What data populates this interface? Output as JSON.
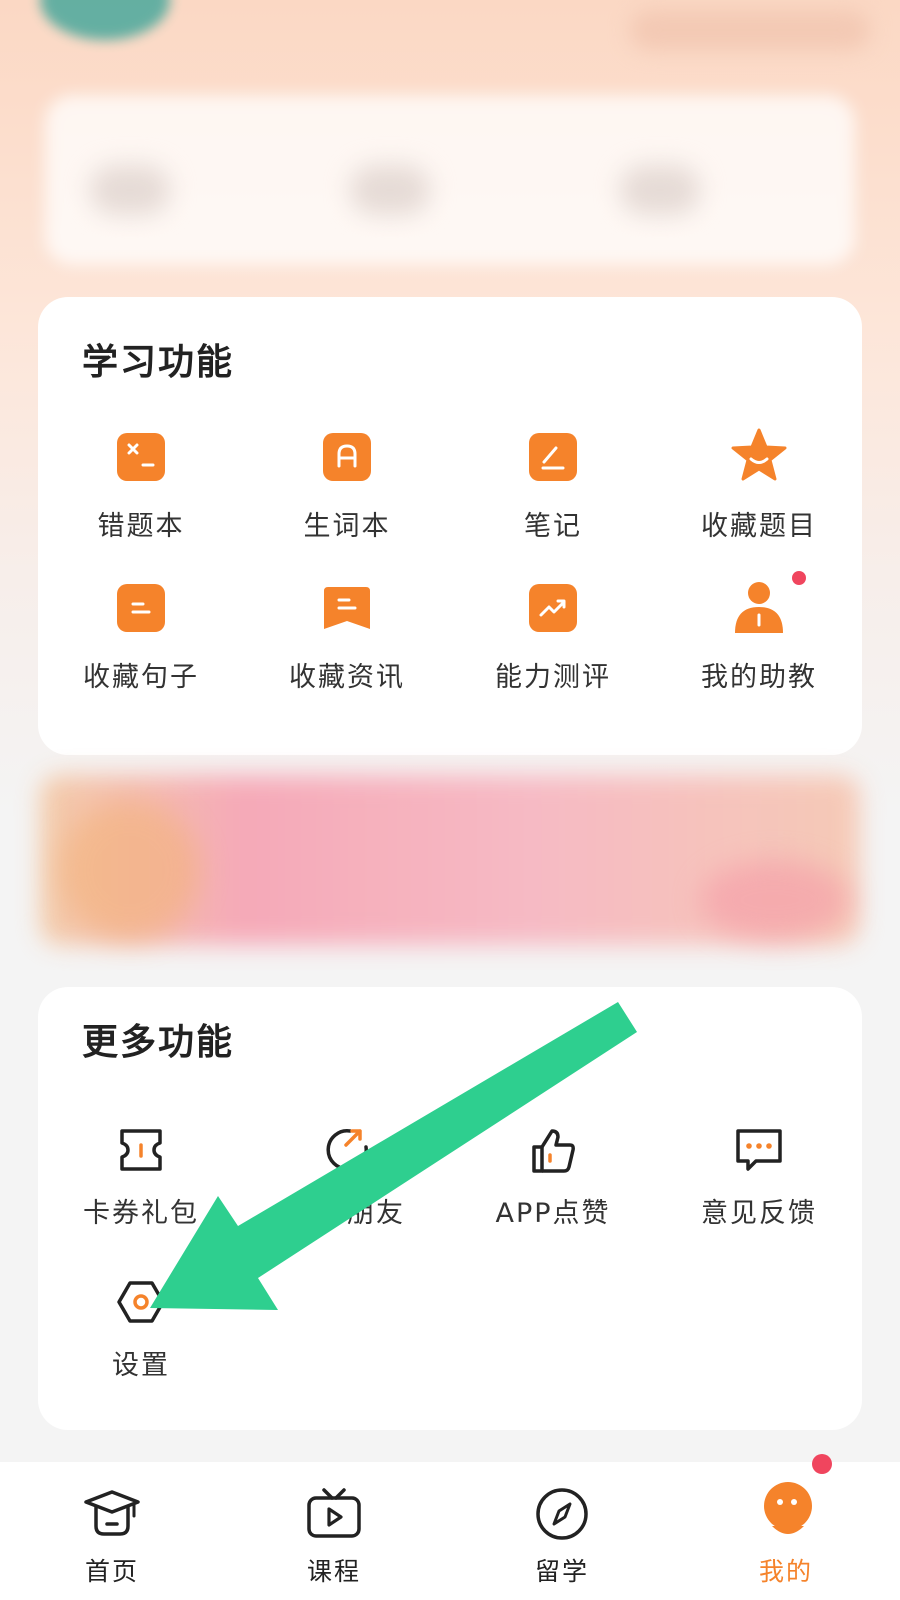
{
  "study_section": {
    "title": "学习功能",
    "items": [
      {
        "label": "错题本",
        "icon": "wrong-questions-icon"
      },
      {
        "label": "生词本",
        "icon": "vocabulary-icon"
      },
      {
        "label": "笔记",
        "icon": "notes-icon"
      },
      {
        "label": "收藏题目",
        "icon": "star-icon"
      },
      {
        "label": "收藏句子",
        "icon": "sentence-icon"
      },
      {
        "label": "收藏资讯",
        "icon": "news-icon"
      },
      {
        "label": "能力测评",
        "icon": "assessment-icon"
      },
      {
        "label": "我的助教",
        "icon": "assistant-icon"
      }
    ]
  },
  "more_section": {
    "title": "更多功能",
    "items": [
      {
        "label": "卡券礼包",
        "icon": "coupon-icon"
      },
      {
        "label": "邀请朋友",
        "icon": "invite-icon"
      },
      {
        "label": "APP点赞",
        "icon": "thumbs-up-icon"
      },
      {
        "label": "意见反馈",
        "icon": "feedback-icon"
      },
      {
        "label": "设置",
        "icon": "settings-icon"
      }
    ]
  },
  "tabbar": {
    "tabs": [
      {
        "label": "首页",
        "icon": "graduation-cap-icon"
      },
      {
        "label": "课程",
        "icon": "tv-play-icon"
      },
      {
        "label": "留学",
        "icon": "compass-icon"
      },
      {
        "label": "我的",
        "icon": "mascot-icon",
        "active": true
      }
    ]
  },
  "colors": {
    "accent": "#f5832b",
    "annotation_arrow": "#2ecf8f",
    "badge": "#f0455e"
  }
}
